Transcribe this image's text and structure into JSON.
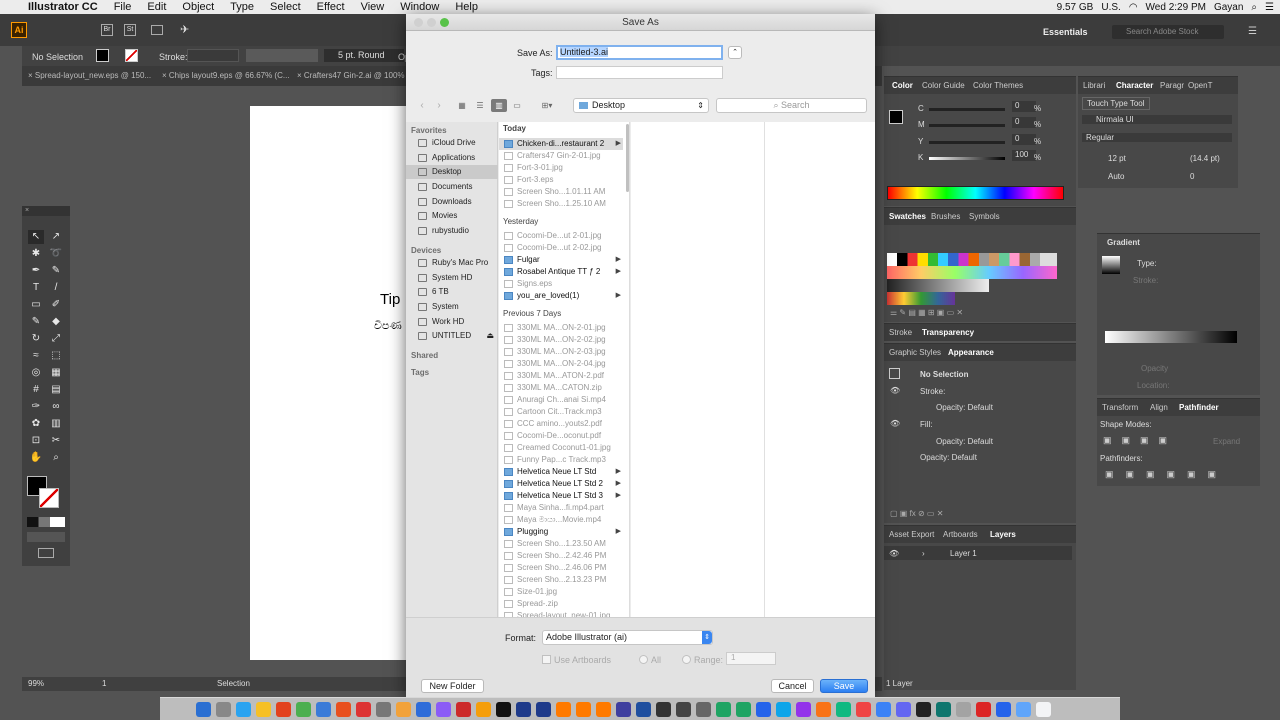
{
  "menubar": {
    "app": "Illustrator CC",
    "items": [
      "File",
      "Edit",
      "Object",
      "Type",
      "Select",
      "Effect",
      "View",
      "Window",
      "Help"
    ],
    "status": {
      "storage": "9.57 GB",
      "input": "U.S.",
      "datetime": "Wed 2:29 PM",
      "user": "Gayan"
    }
  },
  "appbar": {
    "workspace": "Essentials",
    "search_placeholder": "Search Adobe Stock",
    "badges": [
      "Br",
      "St"
    ]
  },
  "controlbar": {
    "selection": "No Selection",
    "stroke_label": "Stroke:",
    "brush": "5 pt. Round",
    "more": "Op"
  },
  "doc_tabs": [
    "Spread-layout_new.eps @ 150...",
    "Chips layout9.eps @ 66.67% (C...",
    "Crafters47 Gin-2.ai @ 100%"
  ],
  "artboard_text": {
    "line1": "Tip",
    "line2": "විපණ"
  },
  "statusbar": {
    "zoom": "99%",
    "page": "1",
    "tool": "Selection"
  },
  "color_panel": {
    "tabs": [
      "Color",
      "Color Guide",
      "Color Themes"
    ],
    "channels": [
      {
        "label": "C",
        "value": "0",
        "pct": "%"
      },
      {
        "label": "M",
        "value": "0",
        "pct": "%"
      },
      {
        "label": "Y",
        "value": "0",
        "pct": "%"
      },
      {
        "label": "K",
        "value": "100",
        "pct": "%"
      }
    ]
  },
  "swatches_panel": {
    "tabs": [
      "Swatches",
      "Brushes",
      "Symbols"
    ]
  },
  "stroke_panel": {
    "tabs": [
      "Stroke",
      "Transparency"
    ]
  },
  "appearance_panel": {
    "tabs": [
      "Graphic Styles",
      "Appearance"
    ],
    "selection": "No Selection",
    "rows": [
      {
        "label": "Stroke:"
      },
      {
        "label": "Opacity: Default"
      },
      {
        "label": "Fill:"
      },
      {
        "label": "Opacity: Default"
      },
      {
        "label": "Opacity: Default"
      }
    ]
  },
  "layers_panel": {
    "tabs": [
      "Asset Export",
      "Artboards",
      "Layers"
    ],
    "layer": "Layer 1",
    "count": "1 Layer"
  },
  "character_panel": {
    "tabs": [
      "Librari",
      "Character",
      "Paragr",
      "OpenT"
    ],
    "tool": "Touch Type Tool",
    "font": "Nirmala UI",
    "style": "Regular",
    "size": "12 pt",
    "leading": "(14.4 pt)",
    "kerning": "Auto",
    "tracking": "0"
  },
  "gradient_panel": {
    "title": "Gradient",
    "type_label": "Type:",
    "labels": [
      "Stroke:",
      "Opacity",
      "Location:"
    ]
  },
  "pathfinder_panel": {
    "tabs": [
      "Transform",
      "Align",
      "Pathfinder"
    ],
    "shape_modes": "Shape Modes:",
    "pathfinders": "Pathfinders:",
    "expand": "Expand"
  },
  "dialog": {
    "title": "Save As",
    "save_as_label": "Save As:",
    "filename": "Untitled-3.ai",
    "tags_label": "Tags:",
    "location": "Desktop",
    "search_placeholder": "Search",
    "sidebar": {
      "favorites_head": "Favorites",
      "favorites": [
        "iCloud Drive",
        "Applications",
        "Desktop",
        "Documents",
        "Downloads",
        "Movies",
        "rubystudio"
      ],
      "devices_head": "Devices",
      "devices": [
        "Ruby's Mac Pro",
        "System HD",
        "6 TB",
        "System",
        "Work HD",
        "UNTITLED"
      ],
      "shared_head": "Shared",
      "tags_head": "Tags"
    },
    "files": {
      "today_head": "Today",
      "today": [
        {
          "name": "Chicken-di...restaurant 2",
          "folder": true
        },
        {
          "name": "Crafters47 Gin-2-01.jpg",
          "folder": false
        },
        {
          "name": "Fort-3-01.jpg",
          "folder": false
        },
        {
          "name": "Fort-3.eps",
          "folder": false
        },
        {
          "name": "Screen Sho...1.01.11 AM",
          "folder": false
        },
        {
          "name": "Screen Sho...1.25.10 AM",
          "folder": false
        }
      ],
      "yesterday_head": "Yesterday",
      "yesterday": [
        {
          "name": "Cocomi-De...ut 2-01.jpg",
          "folder": false
        },
        {
          "name": "Cocomi-De...ut 2-02.jpg",
          "folder": false
        },
        {
          "name": "Fulgar",
          "folder": true
        },
        {
          "name": "Rosabel Antique TT ƒ 2",
          "folder": true
        },
        {
          "name": "Signs.eps",
          "folder": false
        },
        {
          "name": "you_are_loved(1)",
          "folder": true
        }
      ],
      "prev_head": "Previous 7 Days",
      "prev": [
        {
          "name": "330ML MA...ON-2-01.jpg",
          "folder": false
        },
        {
          "name": "330ML MA...ON-2-02.jpg",
          "folder": false
        },
        {
          "name": "330ML MA...ON-2-03.jpg",
          "folder": false
        },
        {
          "name": "330ML MA...ON-2-04.jpg",
          "folder": false
        },
        {
          "name": "330ML MA...ATON-2.pdf",
          "folder": false
        },
        {
          "name": "330ML MA...CATON.zip",
          "folder": false
        },
        {
          "name": "Anuragi Ch...anai Si.mp4",
          "folder": false
        },
        {
          "name": "Cartoon Cit...Track.mp3",
          "folder": false
        },
        {
          "name": "CCC amino...youts2.pdf",
          "folder": false
        },
        {
          "name": "Cocomi-De...oconut.pdf",
          "folder": false
        },
        {
          "name": "Creamed Coconut1-01.jpg",
          "folder": false
        },
        {
          "name": "Funny Pap...c Track.mp3",
          "folder": false
        },
        {
          "name": "Helvetica Neue LT Std",
          "folder": true
        },
        {
          "name": "Helvetica Neue LT Std 2",
          "folder": true
        },
        {
          "name": "Helvetica Neue LT Std 3",
          "folder": true
        },
        {
          "name": "Maya Sinha...fi.mp4.part",
          "folder": false
        },
        {
          "name": "Maya මායා...Movie.mp4",
          "folder": false
        },
        {
          "name": "Plugging",
          "folder": true
        },
        {
          "name": "Screen Sho...1.23.50 AM",
          "folder": false
        },
        {
          "name": "Screen Sho...2.42.46 PM",
          "folder": false
        },
        {
          "name": "Screen Sho...2.46.06 PM",
          "folder": false
        },
        {
          "name": "Screen Sho...2.13.23 PM",
          "folder": false
        },
        {
          "name": "Size-01.jpg",
          "folder": false
        },
        {
          "name": "Spread-.zip",
          "folder": false
        },
        {
          "name": "Spread-layout_new-01.jpg",
          "folder": false
        }
      ]
    },
    "format_label": "Format:",
    "format_value": "Adobe Illustrator (ai)",
    "use_artboards": "Use Artboards",
    "all_label": "All",
    "range_label": "Range:",
    "range_value": "1",
    "new_folder": "New Folder",
    "cancel": "Cancel",
    "save": "Save"
  },
  "colors": {
    "accent": "#2c7ff2",
    "folder": "#6fa8dc",
    "panel": "#484848"
  }
}
